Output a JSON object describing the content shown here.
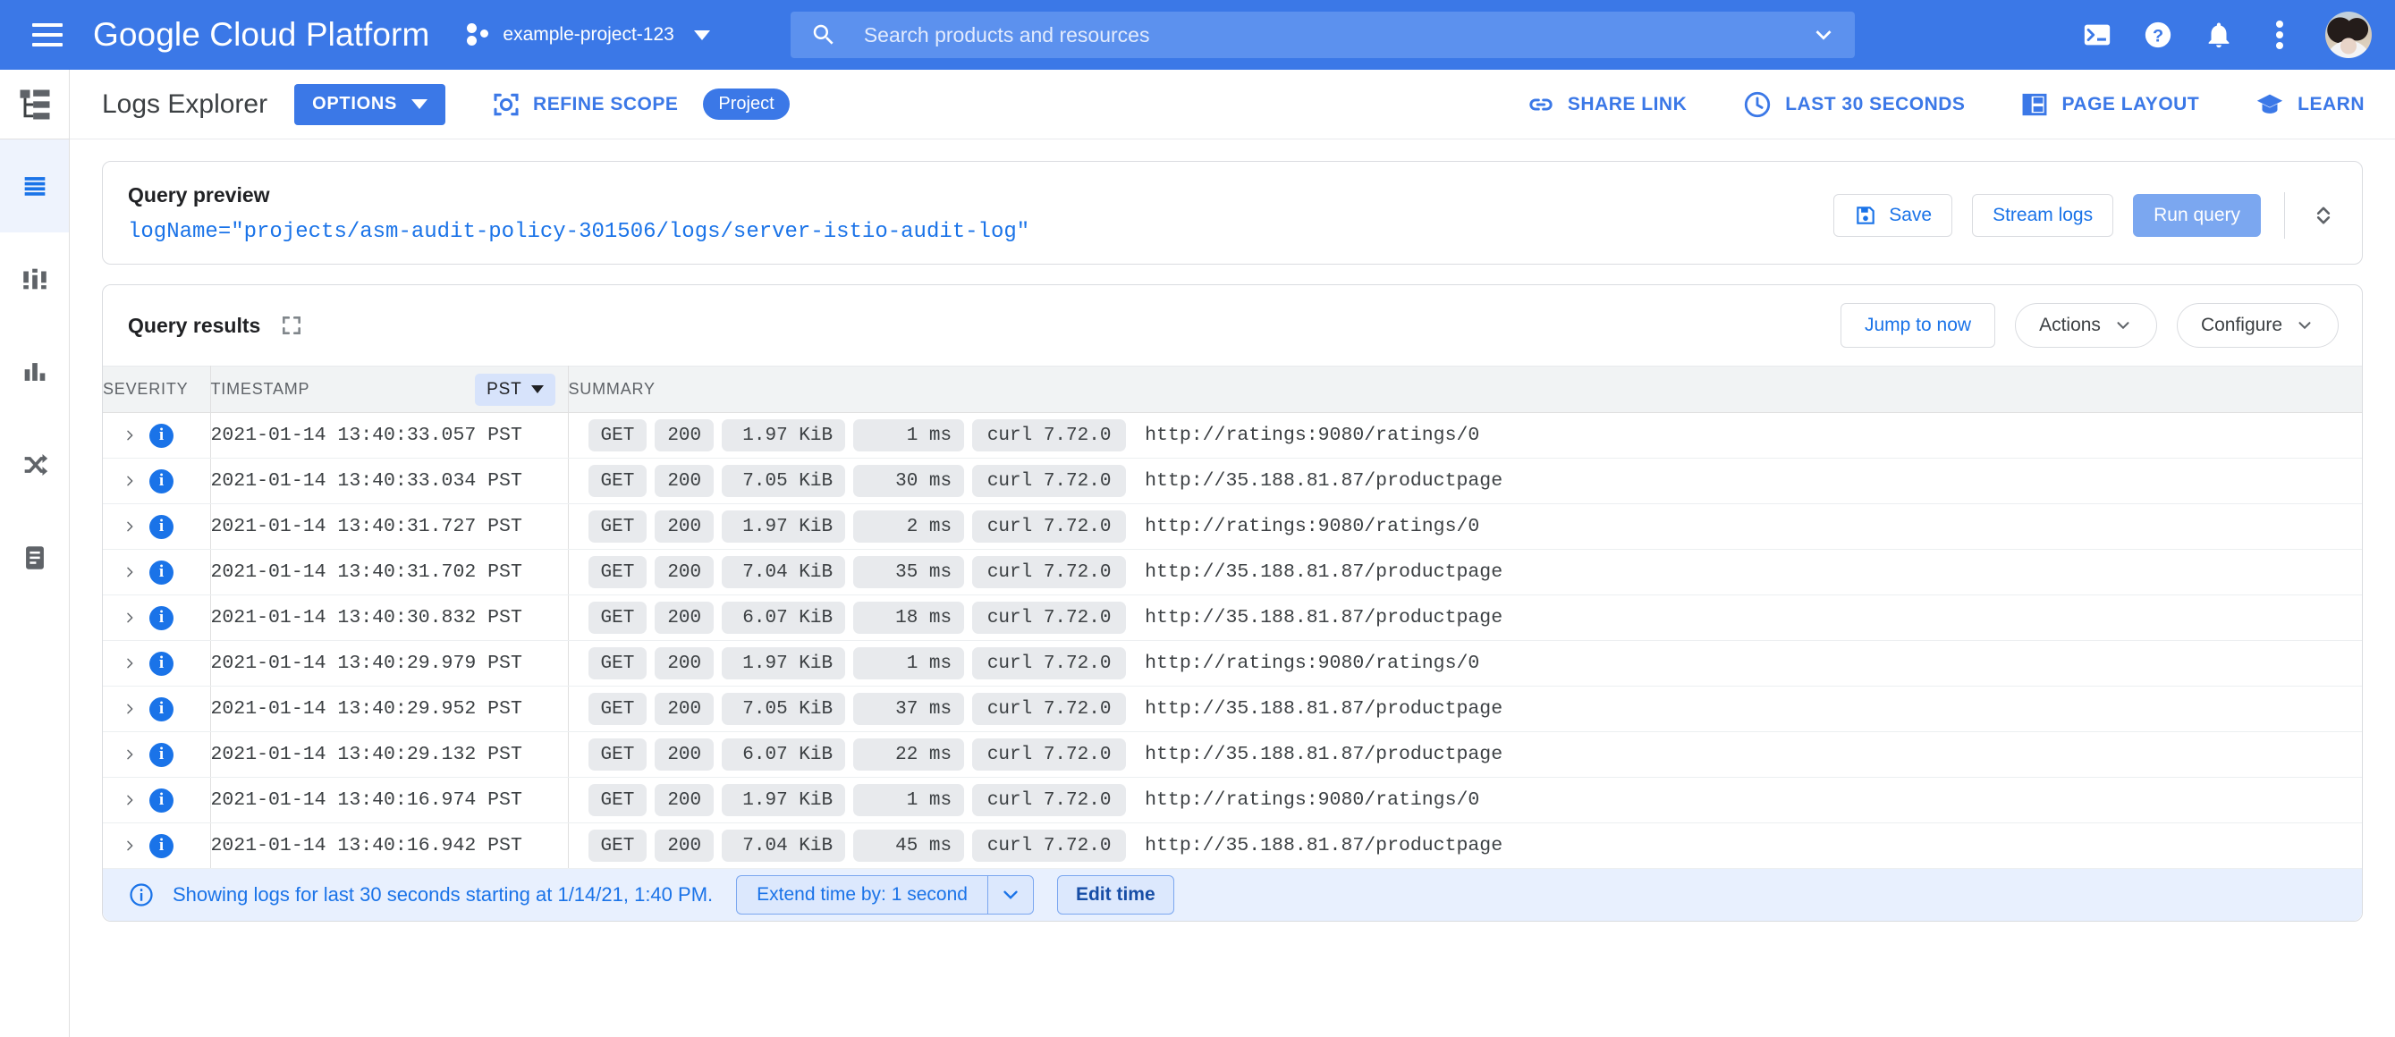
{
  "header": {
    "menu_icon": "hamburger-menu-icon",
    "brand": "Google Cloud Platform",
    "project_name": "example-project-123",
    "project_icon": "project-selector-icon",
    "search": {
      "placeholder": "Search products and resources",
      "value": "",
      "icon": "search-icon",
      "chevron_icon": "chevron-down-icon"
    },
    "icons": [
      "cloud-shell-icon",
      "help-icon",
      "notifications-bell-icon",
      "more-vert-icon"
    ],
    "avatar": "user-avatar"
  },
  "rail": {
    "top_icon": "resource-tree-icon",
    "items": [
      {
        "icon": "logs-explorer-icon",
        "active": true
      },
      {
        "icon": "logs-dashboard-icon",
        "active": false
      },
      {
        "icon": "log-based-metrics-icon",
        "active": false
      },
      {
        "icon": "logs-router-icon",
        "active": false
      },
      {
        "icon": "logs-storage-icon",
        "active": false
      }
    ]
  },
  "toolbar": {
    "page_title": "Logs Explorer",
    "options_label": "OPTIONS",
    "refine_scope_label": "REFINE SCOPE",
    "refine_scope_icon": "scope-icon",
    "scope_chip": "Project",
    "share_link_label": "SHARE LINK",
    "share_link_icon": "link-icon",
    "time_range_label": "LAST 30 SECONDS",
    "time_range_icon": "clock-icon",
    "page_layout_label": "PAGE LAYOUT",
    "page_layout_icon": "layout-icon",
    "learn_label": "LEARN",
    "learn_icon": "graduation-cap-icon"
  },
  "query_preview": {
    "title": "Query preview",
    "query": "logName=\"projects/asm-audit-policy-301506/logs/server-istio-audit-log\"",
    "save_label": "Save",
    "save_icon": "save-icon",
    "stream_logs_label": "Stream logs",
    "run_query_label": "Run query",
    "resize_icon": "expand-collapse-icon"
  },
  "query_results": {
    "title": "Query results",
    "expand_icon": "fullscreen-icon",
    "jump_to_now_label": "Jump to now",
    "actions_label": "Actions",
    "configure_label": "Configure",
    "columns": [
      "SEVERITY",
      "TIMESTAMP",
      "SUMMARY"
    ],
    "timezone": "PST",
    "rows": [
      {
        "severity": "i",
        "timestamp": "2021-01-14 13:40:33.057 PST",
        "method": "GET",
        "status": "200",
        "size": "1.97 KiB",
        "latency": "1 ms",
        "agent": "curl 7.72.0",
        "url": "http://ratings:9080/ratings/0"
      },
      {
        "severity": "i",
        "timestamp": "2021-01-14 13:40:33.034 PST",
        "method": "GET",
        "status": "200",
        "size": "7.05 KiB",
        "latency": "30 ms",
        "agent": "curl 7.72.0",
        "url": "http://35.188.81.87/productpage"
      },
      {
        "severity": "i",
        "timestamp": "2021-01-14 13:40:31.727 PST",
        "method": "GET",
        "status": "200",
        "size": "1.97 KiB",
        "latency": "2 ms",
        "agent": "curl 7.72.0",
        "url": "http://ratings:9080/ratings/0"
      },
      {
        "severity": "i",
        "timestamp": "2021-01-14 13:40:31.702 PST",
        "method": "GET",
        "status": "200",
        "size": "7.04 KiB",
        "latency": "35 ms",
        "agent": "curl 7.72.0",
        "url": "http://35.188.81.87/productpage"
      },
      {
        "severity": "i",
        "timestamp": "2021-01-14 13:40:30.832 PST",
        "method": "GET",
        "status": "200",
        "size": "6.07 KiB",
        "latency": "18 ms",
        "agent": "curl 7.72.0",
        "url": "http://35.188.81.87/productpage"
      },
      {
        "severity": "i",
        "timestamp": "2021-01-14 13:40:29.979 PST",
        "method": "GET",
        "status": "200",
        "size": "1.97 KiB",
        "latency": "1 ms",
        "agent": "curl 7.72.0",
        "url": "http://ratings:9080/ratings/0"
      },
      {
        "severity": "i",
        "timestamp": "2021-01-14 13:40:29.952 PST",
        "method": "GET",
        "status": "200",
        "size": "7.05 KiB",
        "latency": "37 ms",
        "agent": "curl 7.72.0",
        "url": "http://35.188.81.87/productpage"
      },
      {
        "severity": "i",
        "timestamp": "2021-01-14 13:40:29.132 PST",
        "method": "GET",
        "status": "200",
        "size": "6.07 KiB",
        "latency": "22 ms",
        "agent": "curl 7.72.0",
        "url": "http://35.188.81.87/productpage"
      },
      {
        "severity": "i",
        "timestamp": "2021-01-14 13:40:16.974 PST",
        "method": "GET",
        "status": "200",
        "size": "1.97 KiB",
        "latency": "1 ms",
        "agent": "curl 7.72.0",
        "url": "http://ratings:9080/ratings/0"
      },
      {
        "severity": "i",
        "timestamp": "2021-01-14 13:40:16.942 PST",
        "method": "GET",
        "status": "200",
        "size": "7.04 KiB",
        "latency": "45 ms",
        "agent": "curl 7.72.0",
        "url": "http://35.188.81.87/productpage"
      }
    ]
  },
  "notice": {
    "icon": "info-icon",
    "text": "Showing logs for last 30 seconds starting at 1/14/21, 1:40 PM.",
    "extend_label": "Extend time by: 1 second",
    "extend_chevron_icon": "chevron-down-icon",
    "edit_time_label": "Edit time"
  },
  "colors": {
    "brand_blue": "#3b78e7",
    "link_blue": "#1a73e8",
    "run_query_blue": "#7ba7f0",
    "notice_bg": "#e8f0fe",
    "chip_gray": "#e8eaed"
  }
}
